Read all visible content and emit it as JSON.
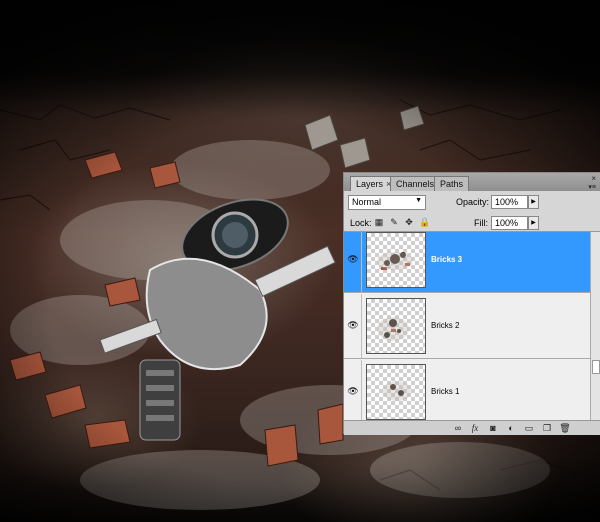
{
  "panel": {
    "tabs": [
      {
        "label": "Layers",
        "close": "×",
        "active": true
      },
      {
        "label": "Channels",
        "active": false
      },
      {
        "label": "Paths",
        "active": false
      }
    ],
    "close_glyph": "×",
    "menu_glyph": "▾≡"
  },
  "blend_mode": {
    "value": "Normal"
  },
  "opacity": {
    "label": "Opacity:",
    "value": "100%"
  },
  "lock": {
    "label": "Lock:"
  },
  "fill": {
    "label": "Fill:",
    "value": "100%"
  },
  "layers": [
    {
      "name": "Bricks 3",
      "selected": true,
      "visible": true
    },
    {
      "name": "Bricks 2",
      "selected": false,
      "visible": true
    },
    {
      "name": "Bricks 1",
      "selected": false,
      "visible": true
    }
  ],
  "icons": {
    "eye": "eye-icon",
    "lock_transparent": "lock-transparent-pixels-icon",
    "lock_image": "lock-image-pixels-icon",
    "lock_position": "lock-position-icon",
    "lock_all": "lock-all-icon",
    "bottom": [
      "link-layers-icon",
      "fx-icon",
      "layer-mask-icon",
      "adjustment-layer-icon",
      "new-group-icon",
      "new-layer-icon",
      "trash-icon"
    ]
  },
  "colors": {
    "selection": "#3399ff",
    "panel_bg": "#d6d6d6"
  }
}
